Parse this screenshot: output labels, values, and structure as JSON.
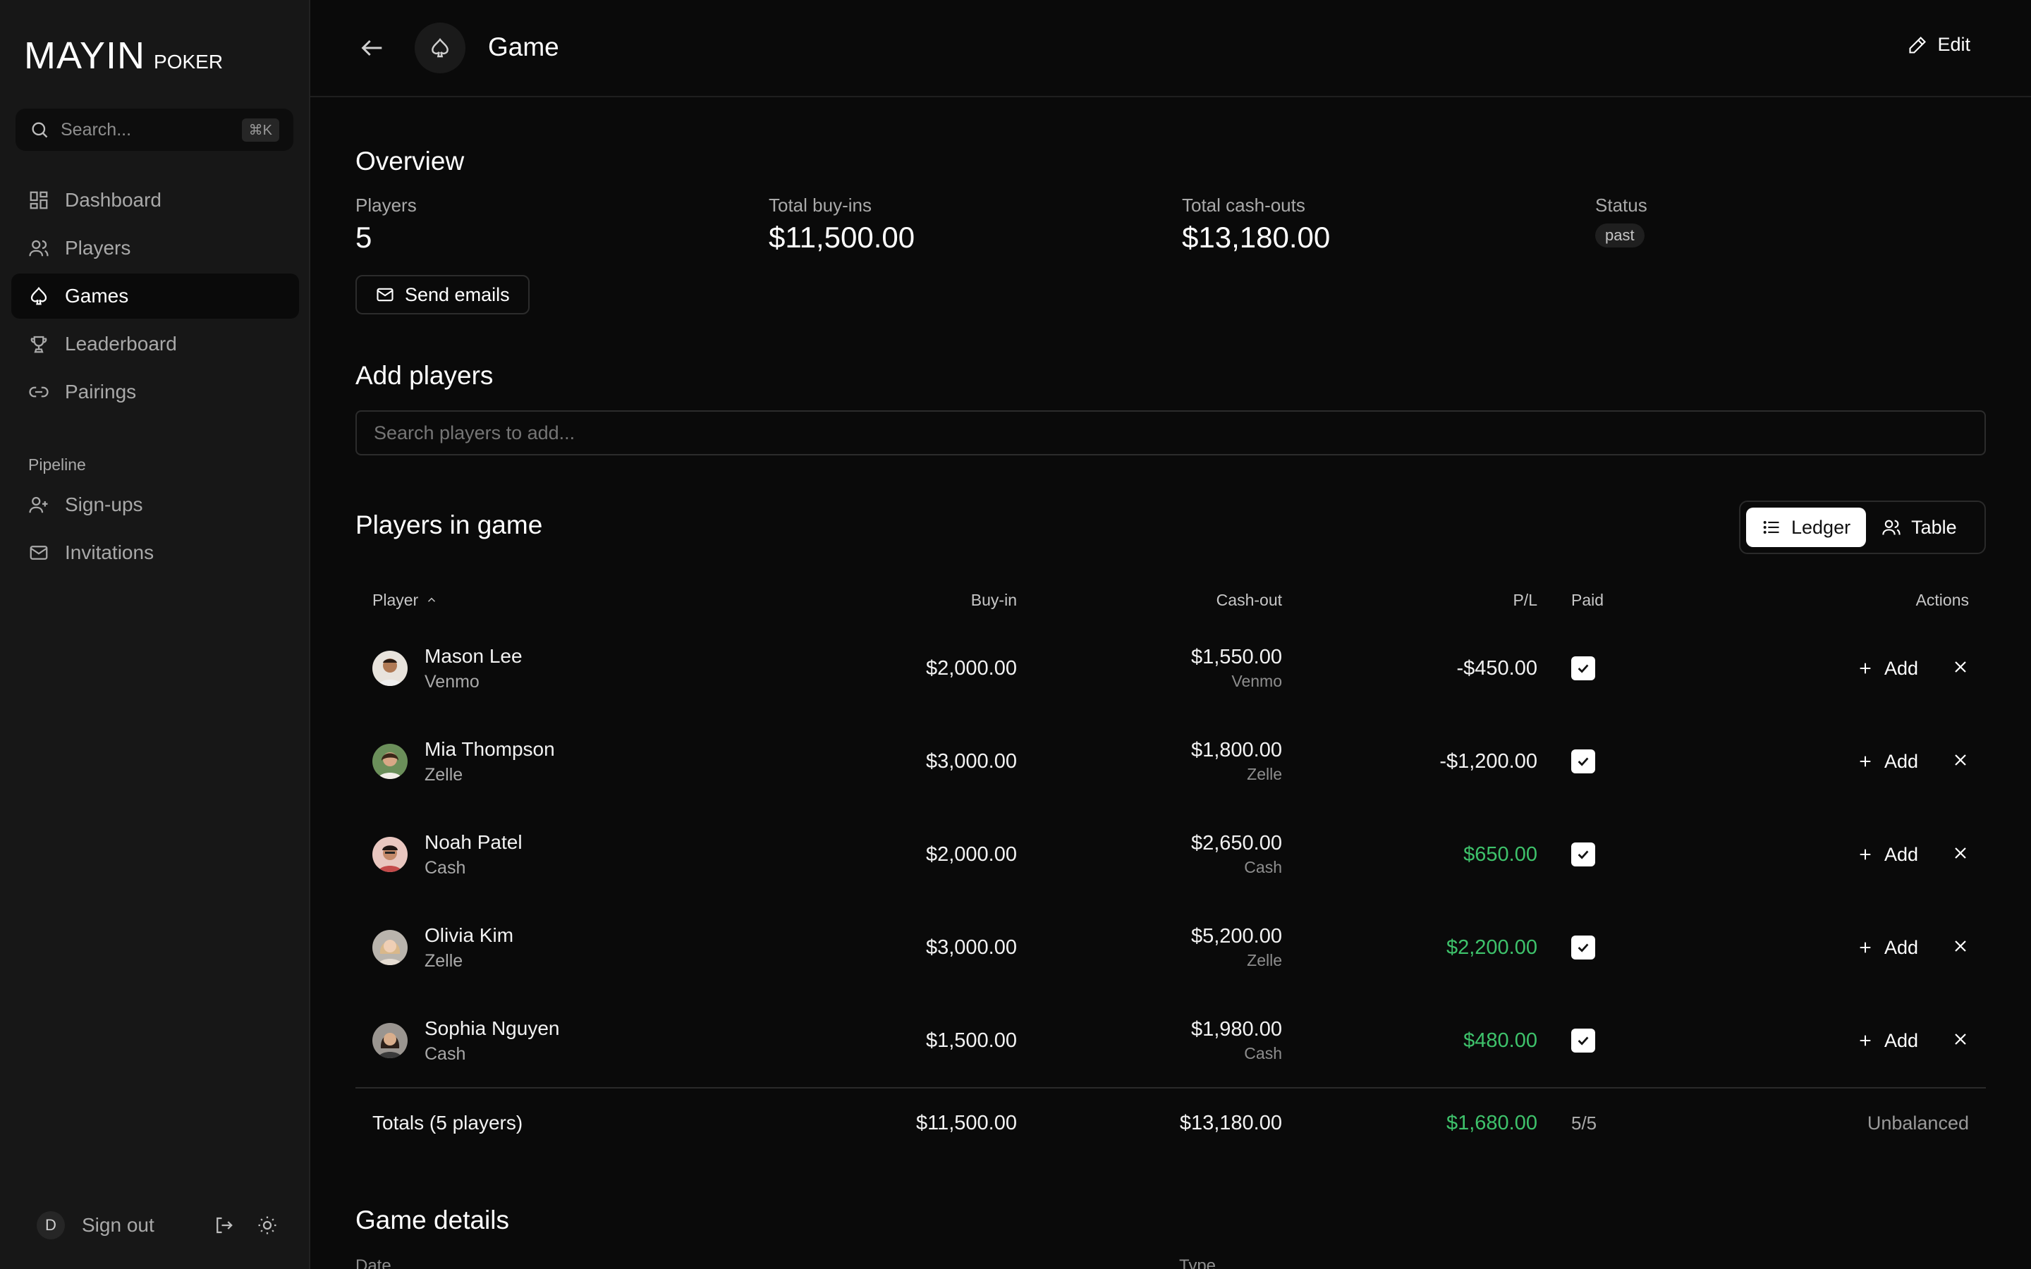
{
  "brand": {
    "main": "MAYIN",
    "sub": "POKER"
  },
  "search": {
    "placeholder": "Search...",
    "shortcut": "⌘K"
  },
  "nav": {
    "items": [
      {
        "label": "Dashboard",
        "icon": "dashboard-icon"
      },
      {
        "label": "Players",
        "icon": "users-icon"
      },
      {
        "label": "Games",
        "icon": "spade-icon",
        "active": true
      },
      {
        "label": "Leaderboard",
        "icon": "trophy-icon"
      },
      {
        "label": "Pairings",
        "icon": "link-icon"
      }
    ],
    "pipeline_label": "Pipeline",
    "pipeline_items": [
      {
        "label": "Sign-ups",
        "icon": "user-plus-icon"
      },
      {
        "label": "Invitations",
        "icon": "mail-icon"
      }
    ]
  },
  "footer": {
    "avatar_initial": "D",
    "signout_label": "Sign out"
  },
  "header": {
    "title": "Game",
    "edit_label": "Edit"
  },
  "overview": {
    "title": "Overview",
    "players_label": "Players",
    "players_value": "5",
    "buyins_label": "Total buy-ins",
    "buyins_value": "$11,500.00",
    "cashouts_label": "Total cash-outs",
    "cashouts_value": "$13,180.00",
    "status_label": "Status",
    "status_value": "past",
    "send_emails_label": "Send emails"
  },
  "add_players": {
    "title": "Add players",
    "placeholder": "Search players to add..."
  },
  "players_in_game": {
    "title": "Players in game",
    "toggle": {
      "ledger": "Ledger",
      "table": "Table",
      "active": "ledger"
    },
    "columns": {
      "player": "Player",
      "buyin": "Buy-in",
      "cashout": "Cash-out",
      "pl": "P/L",
      "paid": "Paid",
      "actions": "Actions"
    },
    "add_label": "Add",
    "rows": [
      {
        "name": "Mason Lee",
        "method": "Venmo",
        "buyin": "$2,000.00",
        "cashout": "$1,550.00",
        "cashout_method": "Venmo",
        "pl": "-$450.00",
        "positive": false,
        "paid": true
      },
      {
        "name": "Mia Thompson",
        "method": "Zelle",
        "buyin": "$3,000.00",
        "cashout": "$1,800.00",
        "cashout_method": "Zelle",
        "pl": "-$1,200.00",
        "positive": false,
        "paid": true
      },
      {
        "name": "Noah Patel",
        "method": "Cash",
        "buyin": "$2,000.00",
        "cashout": "$2,650.00",
        "cashout_method": "Cash",
        "pl": "$650.00",
        "positive": true,
        "paid": true
      },
      {
        "name": "Olivia Kim",
        "method": "Zelle",
        "buyin": "$3,000.00",
        "cashout": "$5,200.00",
        "cashout_method": "Zelle",
        "pl": "$2,200.00",
        "positive": true,
        "paid": true
      },
      {
        "name": "Sophia Nguyen",
        "method": "Cash",
        "buyin": "$1,500.00",
        "cashout": "$1,980.00",
        "cashout_method": "Cash",
        "pl": "$480.00",
        "positive": true,
        "paid": true
      }
    ],
    "totals": {
      "label": "Totals (5 players)",
      "buyin": "$11,500.00",
      "cashout": "$13,180.00",
      "pl": "$1,680.00",
      "paid": "5/5",
      "status": "Unbalanced"
    }
  },
  "game_details": {
    "title": "Game details",
    "date_label": "Date",
    "type_label": "Type"
  },
  "colors": {
    "positive": "#3ec26b",
    "background": "#0a0a0a",
    "sidebar": "#171717"
  }
}
